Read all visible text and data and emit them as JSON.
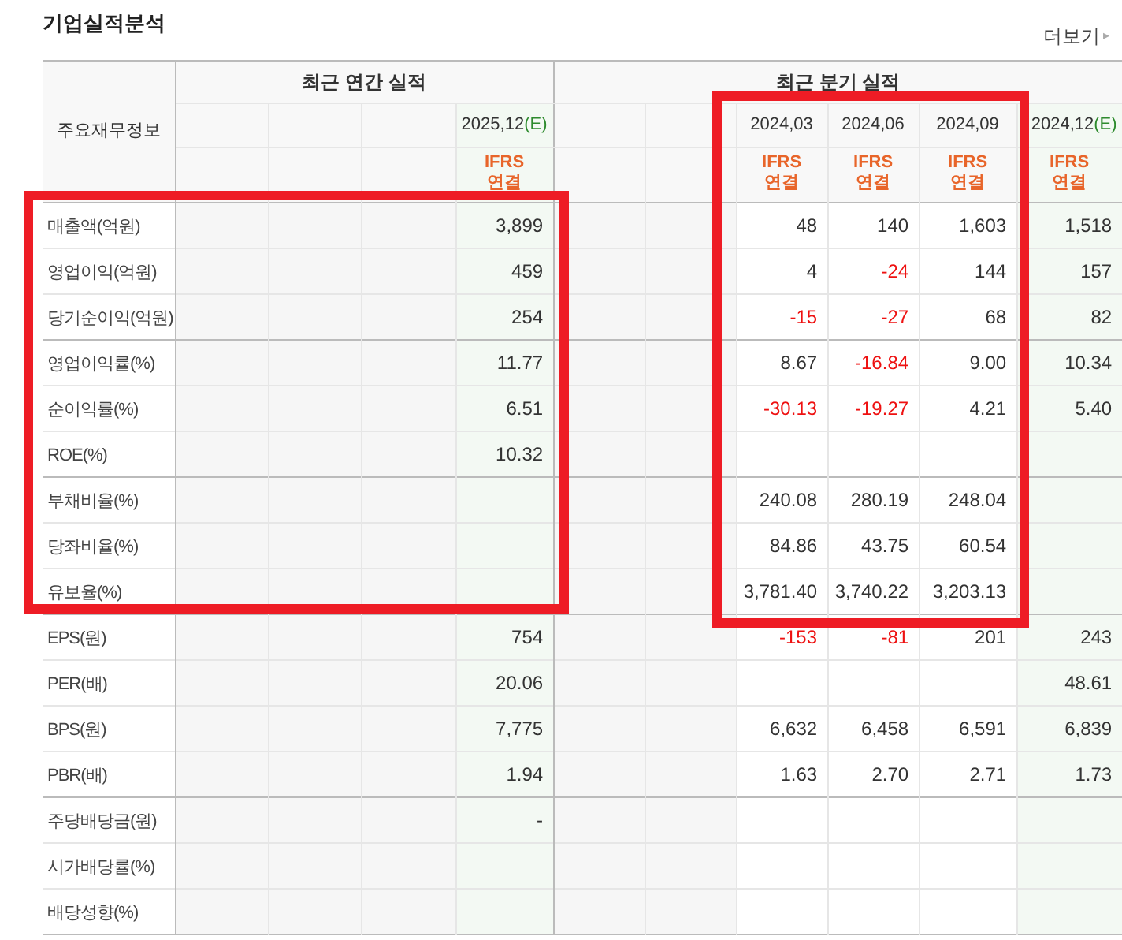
{
  "title": "기업실적분석",
  "more_link": "더보기",
  "more_arrow": "▸",
  "row_header": "주요재무정보",
  "groups": [
    {
      "title": "최근 연간 실적",
      "columns": [
        {
          "kind": "empty"
        },
        {
          "kind": "empty"
        },
        {
          "kind": "empty"
        },
        {
          "kind": "estimate",
          "period": "2025,12",
          "mark": "(E)",
          "accounting": "IFRS",
          "consolidation": "연결"
        }
      ]
    },
    {
      "title": "최근 분기 실적",
      "columns": [
        {
          "kind": "empty"
        },
        {
          "kind": "empty"
        },
        {
          "kind": "actual",
          "period": "2024,03",
          "accounting": "IFRS",
          "consolidation": "연결"
        },
        {
          "kind": "actual",
          "period": "2024,06",
          "accounting": "IFRS",
          "consolidation": "연결"
        },
        {
          "kind": "actual",
          "period": "2024,09",
          "accounting": "IFRS",
          "consolidation": "연결"
        },
        {
          "kind": "estimate",
          "period": "2024,12",
          "mark": "(E)",
          "accounting": "IFRS",
          "consolidation": "연결"
        }
      ]
    }
  ],
  "row_groups": [
    [
      {
        "label": "매출액(억원)",
        "annual_estimate": {
          "value": "3,899",
          "negative": false
        },
        "q1": {
          "value": "48",
          "negative": false
        },
        "q2": {
          "value": "140",
          "negative": false
        },
        "q3": {
          "value": "1,603",
          "negative": false
        },
        "quarter_estimate": {
          "value": "1,518",
          "negative": false
        }
      },
      {
        "label": "영업이익(억원)",
        "annual_estimate": {
          "value": "459",
          "negative": false
        },
        "q1": {
          "value": "4",
          "negative": false
        },
        "q2": {
          "value": "-24",
          "negative": true
        },
        "q3": {
          "value": "144",
          "negative": false
        },
        "quarter_estimate": {
          "value": "157",
          "negative": false
        }
      },
      {
        "label": "당기순이익(억원)",
        "annual_estimate": {
          "value": "254",
          "negative": false
        },
        "q1": {
          "value": "-15",
          "negative": true
        },
        "q2": {
          "value": "-27",
          "negative": true
        },
        "q3": {
          "value": "68",
          "negative": false
        },
        "quarter_estimate": {
          "value": "82",
          "negative": false
        }
      }
    ],
    [
      {
        "label": "영업이익률(%)",
        "annual_estimate": {
          "value": "11.77",
          "negative": false
        },
        "q1": {
          "value": "8.67",
          "negative": false
        },
        "q2": {
          "value": "-16.84",
          "negative": true
        },
        "q3": {
          "value": "9.00",
          "negative": false
        },
        "quarter_estimate": {
          "value": "10.34",
          "negative": false
        }
      },
      {
        "label": "순이익률(%)",
        "annual_estimate": {
          "value": "6.51",
          "negative": false
        },
        "q1": {
          "value": "-30.13",
          "negative": true
        },
        "q2": {
          "value": "-19.27",
          "negative": true
        },
        "q3": {
          "value": "4.21",
          "negative": false
        },
        "quarter_estimate": {
          "value": "5.40",
          "negative": false
        }
      },
      {
        "label": "ROE(%)",
        "annual_estimate": {
          "value": "10.32",
          "negative": false
        }
      }
    ],
    [
      {
        "label": "부채비율(%)",
        "q1": {
          "value": "240.08",
          "negative": false
        },
        "q2": {
          "value": "280.19",
          "negative": false
        },
        "q3": {
          "value": "248.04",
          "negative": false
        }
      },
      {
        "label": "당좌비율(%)",
        "q1": {
          "value": "84.86",
          "negative": false
        },
        "q2": {
          "value": "43.75",
          "negative": false
        },
        "q3": {
          "value": "60.54",
          "negative": false
        }
      },
      {
        "label": "유보율(%)",
        "q1": {
          "value": "3,781.40",
          "negative": false
        },
        "q2": {
          "value": "3,740.22",
          "negative": false
        },
        "q3": {
          "value": "3,203.13",
          "negative": false
        }
      }
    ],
    [
      {
        "label": "EPS(원)",
        "annual_estimate": {
          "value": "754",
          "negative": false
        },
        "q1": {
          "value": "-153",
          "negative": true
        },
        "q2": {
          "value": "-81",
          "negative": true
        },
        "q3": {
          "value": "201",
          "negative": false
        },
        "quarter_estimate": {
          "value": "243",
          "negative": false
        }
      },
      {
        "label": "PER(배)",
        "annual_estimate": {
          "value": "20.06",
          "negative": false
        },
        "quarter_estimate": {
          "value": "48.61",
          "negative": false
        }
      },
      {
        "label": "BPS(원)",
        "annual_estimate": {
          "value": "7,775",
          "negative": false
        },
        "q1": {
          "value": "6,632",
          "negative": false
        },
        "q2": {
          "value": "6,458",
          "negative": false
        },
        "q3": {
          "value": "6,591",
          "negative": false
        },
        "quarter_estimate": {
          "value": "6,839",
          "negative": false
        }
      },
      {
        "label": "PBR(배)",
        "annual_estimate": {
          "value": "1.94",
          "negative": false
        },
        "q1": {
          "value": "1.63",
          "negative": false
        },
        "q2": {
          "value": "2.70",
          "negative": false
        },
        "q3": {
          "value": "2.71",
          "negative": false
        },
        "quarter_estimate": {
          "value": "1.73",
          "negative": false
        }
      }
    ],
    [
      {
        "label": "주당배당금(원)",
        "annual_estimate": {
          "value": "-",
          "negative": false
        }
      },
      {
        "label": "시가배당률(%)"
      },
      {
        "label": "배당성향(%)"
      }
    ]
  ]
}
